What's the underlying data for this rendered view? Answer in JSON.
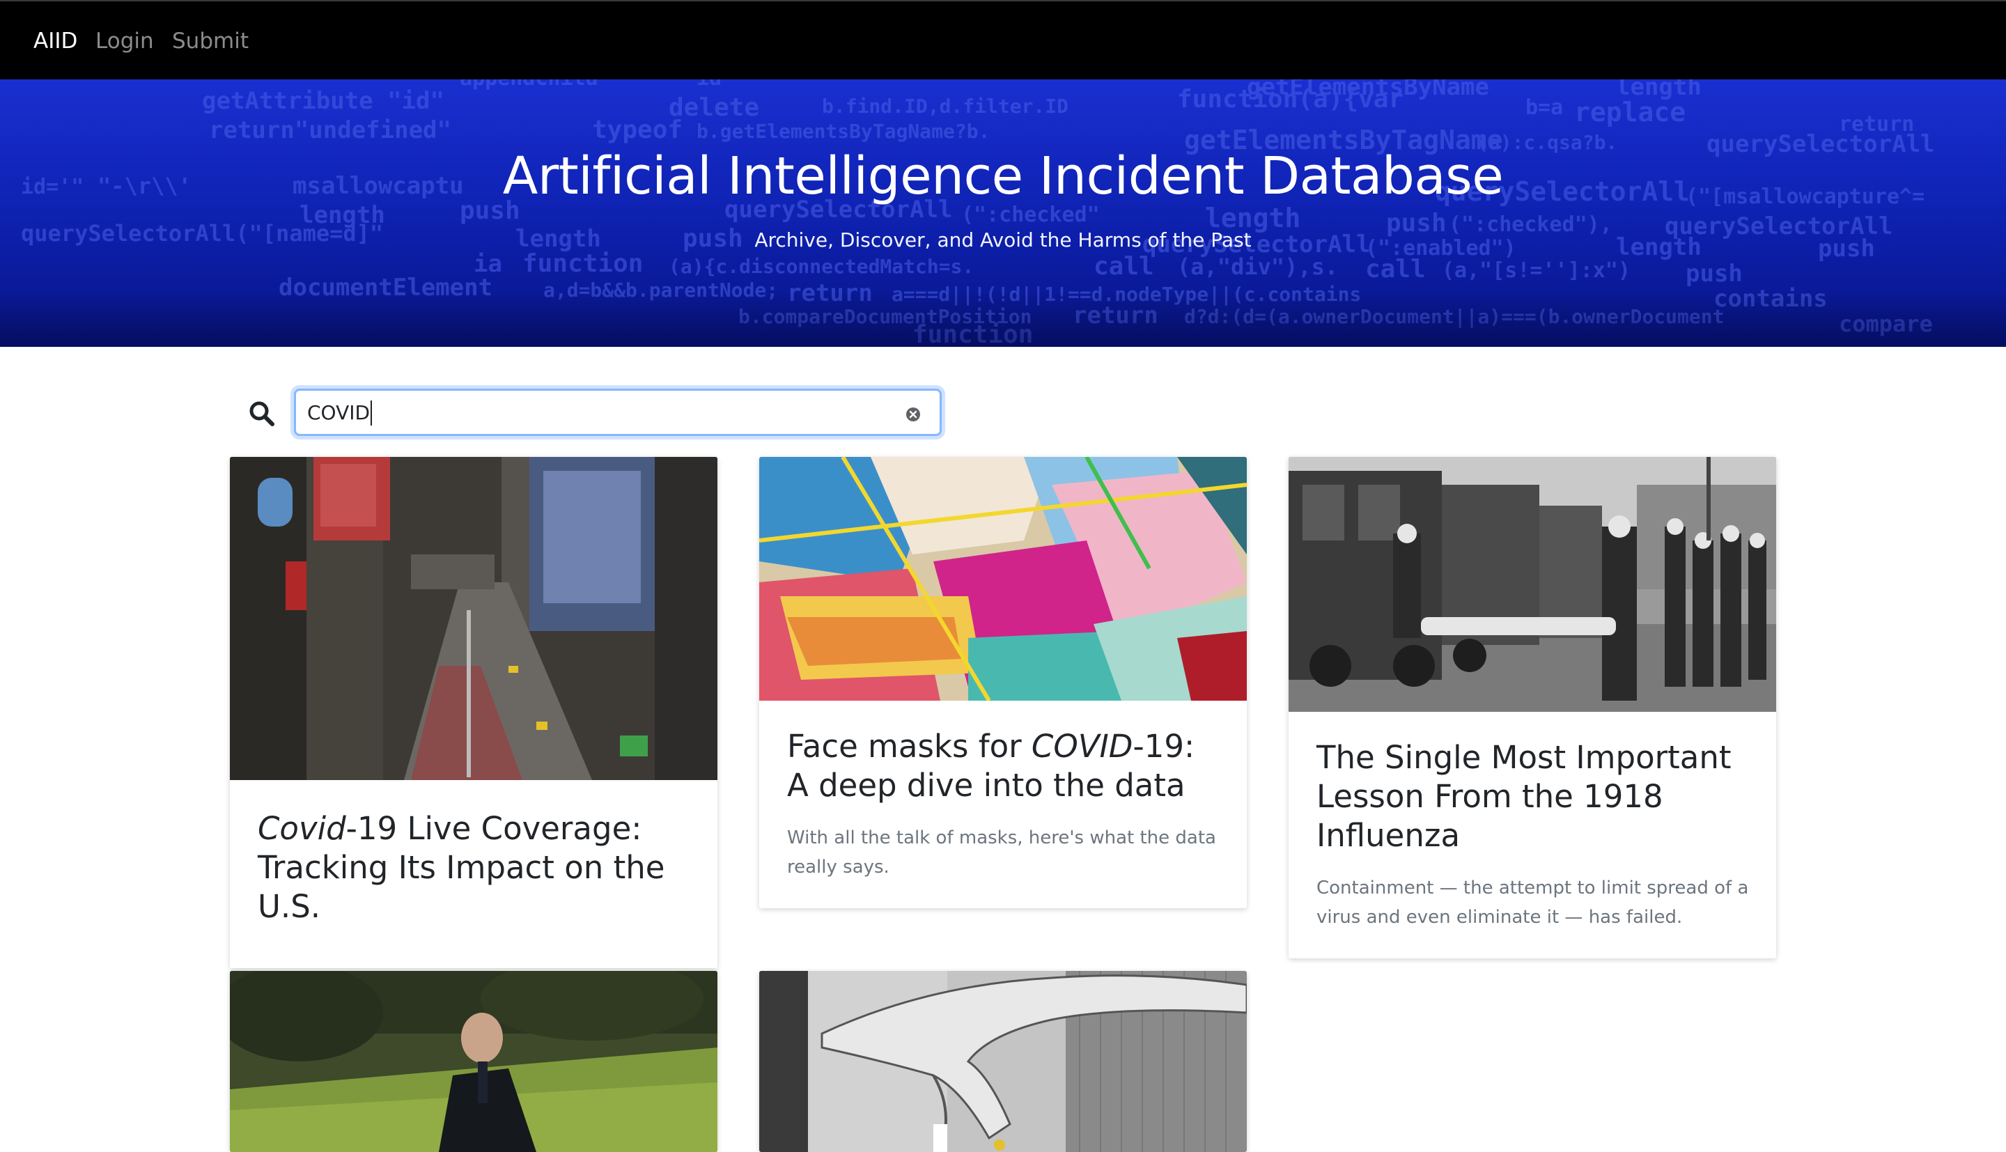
{
  "nav": {
    "brand": "AIID",
    "login": "Login",
    "submit": "Submit"
  },
  "hero": {
    "title": "Artificial Intelligence Incident Database",
    "subtitle": "Archive, Discover, and Avoid the Harms of the Past"
  },
  "search": {
    "value": "COVID",
    "placeholder": "",
    "icon": "search-icon",
    "clear_icon": "clear-icon"
  },
  "cards": [
    {
      "title_em": "Covid",
      "title_rest": "-19 Live Coverage: Tracking Its Impact on the U.S.",
      "description": "",
      "image": "aerial city street with billboards"
    },
    {
      "title_prefix": "Face masks for ",
      "title_em": "COVID",
      "title_rest": "-19: A deep dive into the data",
      "description": "With all the talk of masks, here's what the data really says.",
      "image": "colorful fabric face masks"
    },
    {
      "title": "The Single Most Important Lesson From the 1918 Influenza",
      "description": "Containment — the attempt to limit spread of a virus and even eliminate it — has failed.",
      "image": "historic photo of masked nurses with ambulance"
    },
    {
      "image": "man in suit walking in front of greenery"
    },
    {
      "image": "mural of a giant hand on a building"
    }
  ],
  "colors": {
    "navbar": "#000000",
    "hero": "#1a2fd0",
    "focus_border": "#86b7fe",
    "muted_text": "#6c757d"
  }
}
